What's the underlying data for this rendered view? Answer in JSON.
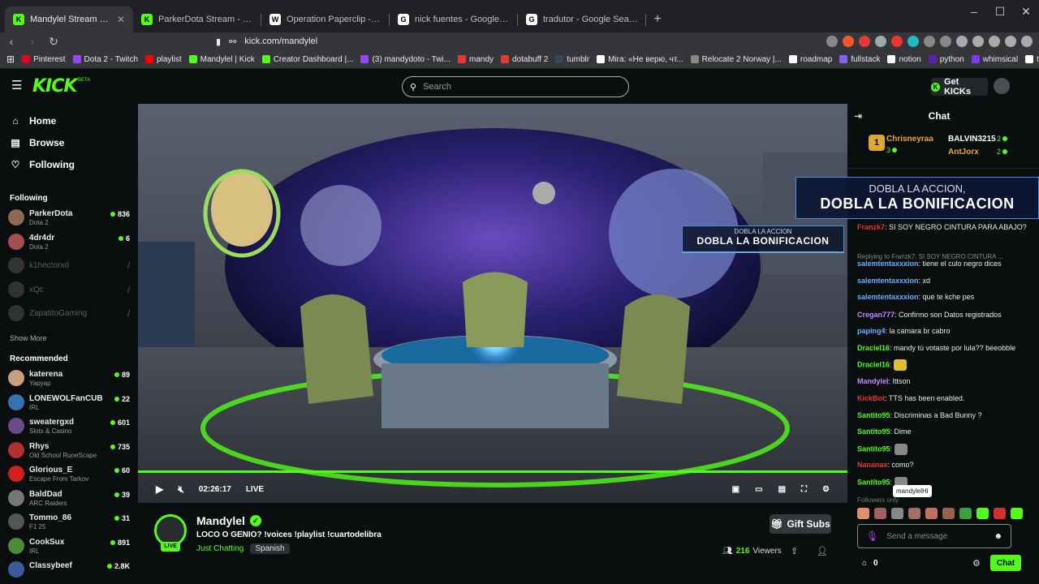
{
  "browser": {
    "tabs": [
      {
        "title": "Mandylel Stream - Watch Live on",
        "fav": "K",
        "favColor": "#53fc18",
        "active": true
      },
      {
        "title": "ParkerDota Stream - Watch Live on K",
        "fav": "K",
        "favColor": "#53fc18"
      },
      {
        "title": "Operation Paperclip - Wikipedia",
        "fav": "W",
        "favColor": "#ffffff"
      },
      {
        "title": "nick fuentes - Google Search",
        "fav": "G",
        "favColor": "#ffffff"
      },
      {
        "title": "tradutor - Google Search",
        "fav": "G",
        "favColor": "#ffffff"
      }
    ],
    "url": "kick.com/mandylel",
    "bookmarks": [
      {
        "label": "Pinterest",
        "color": "#e60023"
      },
      {
        "label": "Dota 2 - Twitch",
        "color": "#9146ff"
      },
      {
        "label": "playlist",
        "color": "#ff0000"
      },
      {
        "label": "Mandylel | Kick",
        "color": "#53fc18"
      },
      {
        "label": "Creator Dashboard |...",
        "color": "#53fc18"
      },
      {
        "label": "(3) mandydoto - Twi...",
        "color": "#9146ff"
      },
      {
        "label": "mandy",
        "color": "#e53935"
      },
      {
        "label": "dotabuff 2",
        "color": "#e53935"
      },
      {
        "label": "tumblr",
        "color": "#36465d"
      },
      {
        "label": "Mira: «Не верю, чт...",
        "color": "#ffffff"
      },
      {
        "label": "Relocate 2 Norway |...",
        "color": "#888888"
      },
      {
        "label": "roadmap",
        "color": "#ffffff"
      },
      {
        "label": "fullstack",
        "color": "#8b5cf6"
      },
      {
        "label": "notion",
        "color": "#ffffff"
      },
      {
        "label": "python",
        "color": "#5b21b6"
      },
      {
        "label": "whimsical",
        "color": "#7c3aed"
      },
      {
        "label": "tldraw",
        "color": "#ffffff"
      }
    ]
  },
  "kick": {
    "logo": "KICK",
    "beta": "BETA",
    "search_placeholder": "Search",
    "get_kicks": "Get KICKs",
    "nav": {
      "home": "Home",
      "browse": "Browse",
      "following": "Following"
    },
    "following_header": "Following",
    "following": [
      {
        "name": "ParkerDota",
        "category": "Dota 2",
        "viewers": "836",
        "live": true,
        "color": "#8a6a50"
      },
      {
        "name": "4dr4dr",
        "category": "Dota 2",
        "viewers": "6",
        "live": true,
        "color": "#a05050"
      },
      {
        "name": "k1hectorxd",
        "live": false,
        "color": "#777"
      },
      {
        "name": "xQc",
        "live": false,
        "color": "#777"
      },
      {
        "name": "ZapatitoGaming",
        "live": false,
        "color": "#777"
      }
    ],
    "show_more": "Show More",
    "recommended_header": "Recommended",
    "recommended": [
      {
        "name": "katerena",
        "category": "Yapyap",
        "viewers": "89",
        "color": "#c9a07a"
      },
      {
        "name": "LONEWOLFanCUB",
        "category": "IRL",
        "viewers": "22",
        "color": "#3a6fb0"
      },
      {
        "name": "sweatergxd",
        "category": "Slots & Casino",
        "viewers": "601",
        "color": "#6b4a8a"
      },
      {
        "name": "Rhys",
        "category": "Old School RuneScape",
        "viewers": "735",
        "color": "#b03030"
      },
      {
        "name": "Glorious_E",
        "category": "Escape From Tarkov",
        "viewers": "60",
        "color": "#d02020"
      },
      {
        "name": "BaldDad",
        "category": "ARC Raiders",
        "viewers": "39",
        "color": "#777"
      },
      {
        "name": "Tommo_86",
        "category": "F1 25",
        "viewers": "31",
        "color": "#555"
      },
      {
        "name": "CookSux",
        "category": "IRL",
        "viewers": "891",
        "color": "#4a8a3a"
      },
      {
        "name": "Classybeef",
        "category": "",
        "viewers": "2.8K",
        "color": "#3a5a9a"
      }
    ]
  },
  "player": {
    "time": "02:26:17",
    "live_label": "LIVE",
    "overlay_a": "DOBLA LA ACCION,",
    "overlay_b": "DOBLA LA BONIFICACION",
    "overlay_small_a": "DOBLA LA ACCION",
    "overlay_small_b": "DOBLA LA BONIFICACION"
  },
  "stream": {
    "name": "Mandylel",
    "title": "LOCO O GENIO? !voices !playlist !cuartodelibra",
    "category": "Just Chatting",
    "language": "Spanish",
    "viewers": "216",
    "viewers_label": "Viewers",
    "gift_subs": "Gift Subs",
    "live_badge": "LIVE"
  },
  "chat": {
    "title": "Chat",
    "leaders": [
      {
        "rank": "1",
        "name": "Chrisneyraa",
        "count": "3",
        "color": "#e0a82e"
      },
      {
        "name": "BALVIN3215",
        "count": "2",
        "color": "#ffffff"
      },
      {
        "name": "AntJorx",
        "count": "2",
        "color": "#e0a82e"
      }
    ],
    "messages": [
      {
        "user": "Franzk7",
        "text": ": SI SOY NEGRO CINTURA PARA ABAJO?",
        "color": "#e53935"
      },
      {
        "user": "",
        "text": "Replying to Franzk7: SI SOY NEGRO CINTURA ...",
        "color": "#888"
      },
      {
        "user": "salemtentaxxxion",
        "text": ": tiene el culo negro dices",
        "color": "#6ab0ff"
      },
      {
        "user": "salemtentaxxxion",
        "text": ": xd",
        "color": "#6ab0ff"
      },
      {
        "user": "salemtentaxxxion",
        "text": ": que te kche pes",
        "color": "#6ab0ff"
      },
      {
        "user": "Cregan777",
        "text": ": Confirmo son Datos registrados",
        "color": "#c08cff"
      },
      {
        "user": "paping4",
        "text": ": la camara br cabro",
        "color": "#6ab0ff"
      },
      {
        "user": "Draciel16",
        "text": ": mandy tú votaste por lula?? beeobble",
        "color": "#53fc18"
      },
      {
        "user": "Draciel16",
        "text": ":",
        "color": "#53fc18",
        "emote": "#e0c030"
      },
      {
        "user": "Mandylel",
        "text": ": Ittson",
        "color": "#c08cff"
      },
      {
        "user": "KickBot",
        "text": ": TTS has been enabled.",
        "color": "#e53935"
      },
      {
        "user": "Santito95",
        "text": ": Discriminas a Bad Bunny ?",
        "color": "#53fc18"
      },
      {
        "user": "Santito95",
        "text": ": Dime",
        "color": "#53fc18"
      },
      {
        "user": "Santito95",
        "text": ":",
        "color": "#53fc18",
        "emote": "#888"
      },
      {
        "user": "Nananax",
        "text": ": como?",
        "color": "#e53935"
      },
      {
        "user": "Santito95",
        "text": ":",
        "color": "#53fc18",
        "emote": "#888"
      }
    ],
    "followers_only": "Followers only",
    "tooltip": "mandylelHi",
    "emote_colors": [
      "#e09070",
      "#a06060",
      "#888",
      "#a07060",
      "#c07060",
      "#9a6050",
      "#3aa040",
      "#53fc18",
      "#d03030",
      "#53fc18"
    ],
    "input_placeholder": "Send a message",
    "points": "0",
    "send_label": "Chat"
  }
}
